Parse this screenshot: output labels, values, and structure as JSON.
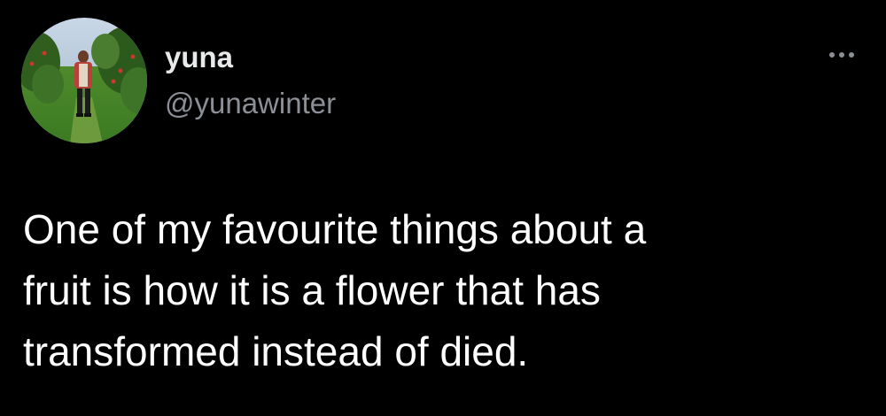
{
  "author": {
    "display_name": "yuna",
    "handle": "@yunawinter",
    "avatar_icon": "profile-photo-orchard"
  },
  "tweet": {
    "text": "One of my favourite things about a\nfruit is how it is a flower that has\ntransformed instead of died."
  },
  "menu": {
    "icon": "more-horizontal-icon"
  },
  "colors": {
    "background": "#000000",
    "primary_text": "#ffffff",
    "secondary_text": "#8b9096"
  }
}
